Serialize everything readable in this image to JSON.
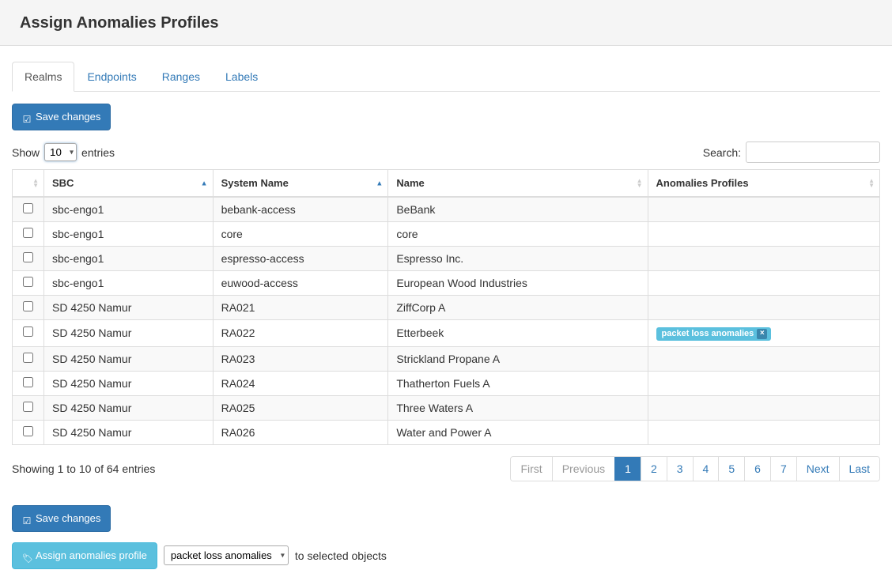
{
  "header": {
    "title": "Assign Anomalies Profiles"
  },
  "tabs": [
    {
      "label": "Realms",
      "active": true
    },
    {
      "label": "Endpoints",
      "active": false
    },
    {
      "label": "Ranges",
      "active": false
    },
    {
      "label": "Labels",
      "active": false
    }
  ],
  "buttons": {
    "save": "Save changes",
    "assign": "Assign anomalies profile"
  },
  "length": {
    "pre": "Show",
    "post": "entries",
    "value": "10"
  },
  "search": {
    "label": "Search:",
    "value": ""
  },
  "columns": [
    {
      "label": "",
      "checkbox": true
    },
    {
      "label": "SBC",
      "sort": "asc"
    },
    {
      "label": "System Name",
      "sort": "asc"
    },
    {
      "label": "Name",
      "sort": "both"
    },
    {
      "label": "Anomalies Profiles",
      "sort": "both"
    }
  ],
  "rows": [
    {
      "sbc": "sbc-engo1",
      "system": "bebank-access",
      "name": "BeBank",
      "profiles": []
    },
    {
      "sbc": "sbc-engo1",
      "system": "core",
      "name": "core",
      "profiles": []
    },
    {
      "sbc": "sbc-engo1",
      "system": "espresso-access",
      "name": "Espresso Inc.",
      "profiles": []
    },
    {
      "sbc": "sbc-engo1",
      "system": "euwood-access",
      "name": "European Wood Industries",
      "profiles": []
    },
    {
      "sbc": "SD 4250 Namur",
      "system": "RA021",
      "name": "ZiffCorp A",
      "profiles": []
    },
    {
      "sbc": "SD 4250 Namur",
      "system": "RA022",
      "name": "Etterbeek",
      "profiles": [
        "packet loss anomalies"
      ]
    },
    {
      "sbc": "SD 4250 Namur",
      "system": "RA023",
      "name": "Strickland Propane A",
      "profiles": []
    },
    {
      "sbc": "SD 4250 Namur",
      "system": "RA024",
      "name": "Thatherton Fuels A",
      "profiles": []
    },
    {
      "sbc": "SD 4250 Namur",
      "system": "RA025",
      "name": "Three Waters A",
      "profiles": []
    },
    {
      "sbc": "SD 4250 Namur",
      "system": "RA026",
      "name": "Water and Power A",
      "profiles": []
    }
  ],
  "info": "Showing 1 to 10 of 64 entries",
  "pagination": {
    "first": "First",
    "previous": "Previous",
    "pages": [
      "1",
      "2",
      "3",
      "4",
      "5",
      "6",
      "7"
    ],
    "active": "1",
    "next": "Next",
    "last": "Last"
  },
  "assign": {
    "select_value": "packet loss anomalies",
    "suffix": "to selected objects"
  }
}
